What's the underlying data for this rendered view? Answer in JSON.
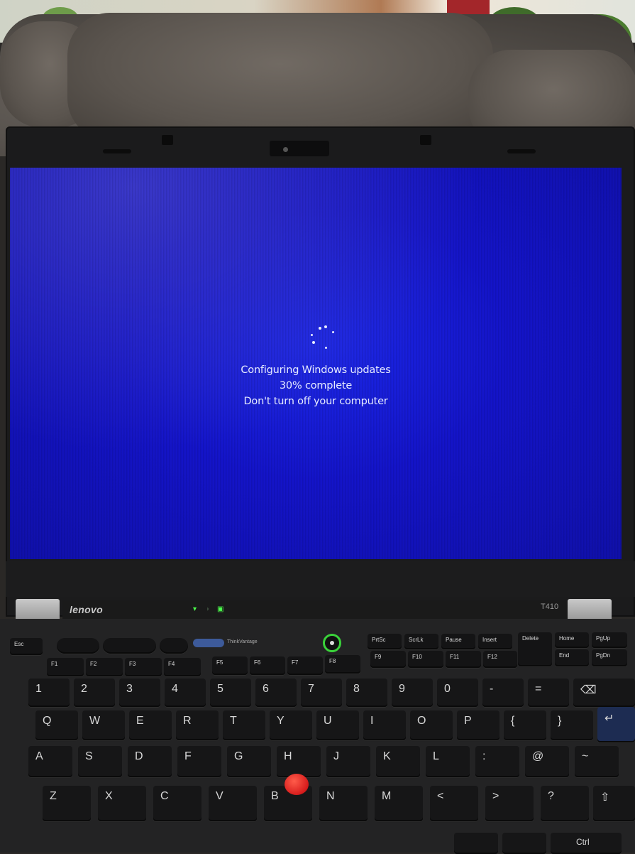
{
  "update_screen": {
    "line1": "Configuring Windows updates",
    "line2": "30% complete",
    "line3": "Don't turn off your computer",
    "progress_percent": 30
  },
  "laptop": {
    "brand": "lenovo",
    "model": "T410",
    "thinkvantage_label": "ThinkVantage"
  },
  "keyboard": {
    "function_keys": [
      "Esc",
      "F1",
      "F2",
      "F3",
      "F4",
      "F5",
      "F6",
      "F7",
      "F8",
      "F9",
      "F10",
      "F11",
      "F12",
      "PrtSc",
      "ScrLk",
      "Pause",
      "Insert",
      "Delete",
      "Home",
      "PgUp",
      "End",
      "PgDn"
    ],
    "number_row": [
      "1",
      "2",
      "3",
      "4",
      "5",
      "6",
      "7",
      "8",
      "9",
      "0",
      "-",
      "="
    ],
    "row_q": [
      "Q",
      "W",
      "E",
      "R",
      "T",
      "Y",
      "U",
      "I",
      "O",
      "P",
      "{",
      "}"
    ],
    "row_a": [
      "A",
      "S",
      "D",
      "F",
      "G",
      "H",
      "J",
      "K",
      "L",
      ":",
      "@",
      "~"
    ],
    "row_z": [
      "Z",
      "X",
      "C",
      "V",
      "B",
      "N",
      "M",
      "<",
      ">",
      "?"
    ],
    "ctrl_label": "Ctrl"
  },
  "colors": {
    "screen_blue": "#1414c8",
    "text": "#e6ebff",
    "power_ring": "#3ad23a",
    "trackpoint": "#d71c1c"
  }
}
